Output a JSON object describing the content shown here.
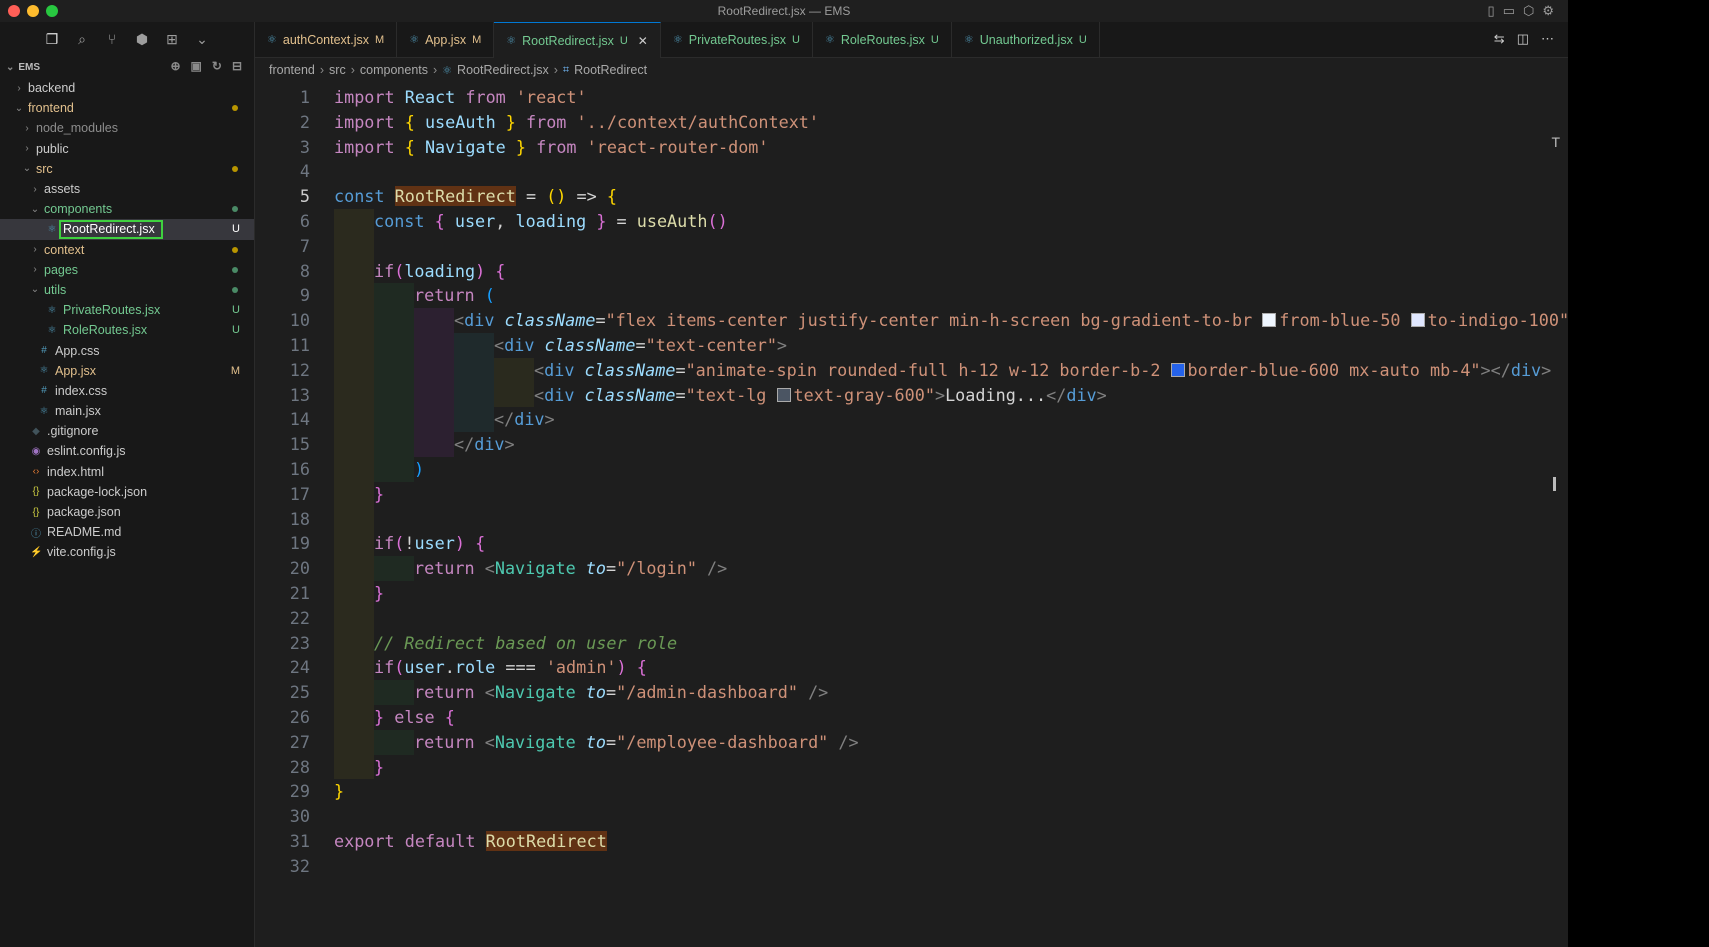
{
  "window": {
    "title": "RootRedirect.jsx — EMS"
  },
  "explorer": {
    "root": "EMS",
    "tree": [
      {
        "label": "backend",
        "kind": "folder",
        "depth": 0,
        "open": false,
        "color": "#cccccc"
      },
      {
        "label": "frontend",
        "kind": "folder",
        "depth": 0,
        "open": true,
        "color": "#e2c08d",
        "dot": "#b89500"
      },
      {
        "label": "node_modules",
        "kind": "folder",
        "depth": 1,
        "open": false,
        "color": "#8c8c8c"
      },
      {
        "label": "public",
        "kind": "folder",
        "depth": 1,
        "open": false,
        "color": "#cccccc"
      },
      {
        "label": "src",
        "kind": "folder",
        "depth": 1,
        "open": true,
        "color": "#e2c08d",
        "dot": "#b89500"
      },
      {
        "label": "assets",
        "kind": "folder",
        "depth": 2,
        "open": false,
        "color": "#cccccc"
      },
      {
        "label": "components",
        "kind": "folder",
        "depth": 2,
        "open": true,
        "color": "#73c991",
        "dot": "#4a8a66"
      },
      {
        "label": "RootRedirect.jsx",
        "kind": "file",
        "depth": 3,
        "icon": "react",
        "color": "#ffffff",
        "badge": "U",
        "selected": true
      },
      {
        "label": "context",
        "kind": "folder",
        "depth": 2,
        "open": false,
        "color": "#e2c08d",
        "dot": "#b89500"
      },
      {
        "label": "pages",
        "kind": "folder",
        "depth": 2,
        "open": false,
        "color": "#73c991",
        "dot": "#4a8a66"
      },
      {
        "label": "utils",
        "kind": "folder",
        "depth": 2,
        "open": true,
        "color": "#73c991",
        "dot": "#4a8a66"
      },
      {
        "label": "PrivateRoutes.jsx",
        "kind": "file",
        "depth": 3,
        "icon": "react",
        "color": "#73c991",
        "badge": "U"
      },
      {
        "label": "RoleRoutes.jsx",
        "kind": "file",
        "depth": 3,
        "icon": "react",
        "color": "#73c991",
        "badge": "U"
      },
      {
        "label": "App.css",
        "kind": "file",
        "depth": 2,
        "icon": "hash",
        "color": "#cccccc"
      },
      {
        "label": "App.jsx",
        "kind": "file",
        "depth": 2,
        "icon": "react",
        "color": "#e2c08d",
        "badge": "M"
      },
      {
        "label": "index.css",
        "kind": "file",
        "depth": 2,
        "icon": "hash",
        "color": "#cccccc"
      },
      {
        "label": "main.jsx",
        "kind": "file",
        "depth": 2,
        "icon": "react",
        "color": "#cccccc"
      },
      {
        "label": ".gitignore",
        "kind": "file",
        "depth": 1,
        "icon": "git",
        "color": "#cccccc"
      },
      {
        "label": "eslint.config.js",
        "kind": "file",
        "depth": 1,
        "icon": "eslint",
        "color": "#cccccc"
      },
      {
        "label": "index.html",
        "kind": "file",
        "depth": 1,
        "icon": "html",
        "color": "#cccccc"
      },
      {
        "label": "package-lock.json",
        "kind": "file",
        "depth": 1,
        "icon": "json",
        "color": "#cccccc"
      },
      {
        "label": "package.json",
        "kind": "file",
        "depth": 1,
        "icon": "json",
        "color": "#cccccc"
      },
      {
        "label": "README.md",
        "kind": "file",
        "depth": 1,
        "icon": "info",
        "color": "#cccccc"
      },
      {
        "label": "vite.config.js",
        "kind": "file",
        "depth": 1,
        "icon": "vite",
        "color": "#cccccc"
      }
    ]
  },
  "tabs": [
    {
      "label": "authContext.jsx",
      "status": "M",
      "color": "#e2c08d"
    },
    {
      "label": "App.jsx",
      "status": "M",
      "color": "#e2c08d"
    },
    {
      "label": "RootRedirect.jsx",
      "status": "U",
      "color": "#73c991",
      "active": true
    },
    {
      "label": "PrivateRoutes.jsx",
      "status": "U",
      "color": "#73c991"
    },
    {
      "label": "RoleRoutes.jsx",
      "status": "U",
      "color": "#73c991"
    },
    {
      "label": "Unauthorized.jsx",
      "status": "U",
      "color": "#73c991"
    }
  ],
  "breadcrumb": [
    "frontend",
    "src",
    "components",
    "RootRedirect.jsx",
    "RootRedirect"
  ],
  "editor": {
    "current_line": 5,
    "lines": [
      {
        "n": 1,
        "indent": 0,
        "tokens": [
          [
            "import ",
            "kw"
          ],
          [
            "React ",
            "var"
          ],
          [
            "from ",
            "kw"
          ],
          [
            "'react'",
            "str"
          ]
        ]
      },
      {
        "n": 2,
        "indent": 0,
        "tokens": [
          [
            "import ",
            "kw"
          ],
          [
            "{ ",
            "b1"
          ],
          [
            "useAuth ",
            "var"
          ],
          [
            "} ",
            "b1"
          ],
          [
            "from ",
            "kw"
          ],
          [
            "'../context/authContext'",
            "str"
          ]
        ]
      },
      {
        "n": 3,
        "indent": 0,
        "tokens": [
          [
            "import ",
            "kw"
          ],
          [
            "{ ",
            "b1"
          ],
          [
            "Navigate ",
            "var"
          ],
          [
            "} ",
            "b1"
          ],
          [
            "from ",
            "kw"
          ],
          [
            "'react-router-dom'",
            "str"
          ]
        ]
      },
      {
        "n": 4,
        "indent": 0,
        "tokens": []
      },
      {
        "n": 5,
        "indent": 0,
        "tokens": [
          [
            "const ",
            "kb"
          ],
          [
            "RootRedirect",
            "fn hlbox"
          ],
          [
            " = ",
            ""
          ],
          [
            "()",
            "b1"
          ],
          [
            " => ",
            ""
          ],
          [
            "{",
            "b1"
          ]
        ]
      },
      {
        "n": 6,
        "indent": 1,
        "tokens": [
          [
            "const ",
            "kb"
          ],
          [
            "{ ",
            "b2"
          ],
          [
            "user",
            "var"
          ],
          [
            ", ",
            ""
          ],
          [
            "loading ",
            "var"
          ],
          [
            "} ",
            "b2"
          ],
          [
            "= ",
            ""
          ],
          [
            "useAuth",
            "fn"
          ],
          [
            "()",
            "b2"
          ]
        ]
      },
      {
        "n": 7,
        "indent": 1,
        "tokens": []
      },
      {
        "n": 8,
        "indent": 1,
        "tokens": [
          [
            "if",
            "kw"
          ],
          [
            "(",
            "b2"
          ],
          [
            "loading",
            "var"
          ],
          [
            ") ",
            "b2"
          ],
          [
            "{",
            "b2"
          ]
        ]
      },
      {
        "n": 9,
        "indent": 2,
        "tokens": [
          [
            "return ",
            "kw"
          ],
          [
            "(",
            "b3"
          ]
        ]
      },
      {
        "n": 10,
        "indent": 3,
        "tokens": [
          [
            "<",
            "pn"
          ],
          [
            "div ",
            "tag"
          ],
          [
            "className",
            "attr"
          ],
          [
            "=",
            ""
          ],
          [
            "\"flex items-center justify-center min-h-screen bg-gradient-to-br ",
            "str"
          ],
          [
            "#eff6ff",
            "swatch"
          ],
          [
            "from-blue-50 ",
            "str"
          ],
          [
            "#e0e7ff",
            "swatch"
          ],
          [
            "to-indigo-100\"",
            "str"
          ],
          [
            ">",
            "pn"
          ]
        ]
      },
      {
        "n": 11,
        "indent": 4,
        "tokens": [
          [
            "<",
            "pn"
          ],
          [
            "div ",
            "tag"
          ],
          [
            "className",
            "attr"
          ],
          [
            "=",
            ""
          ],
          [
            "\"text-center\"",
            "str"
          ],
          [
            ">",
            "pn"
          ]
        ]
      },
      {
        "n": 12,
        "indent": 5,
        "tokens": [
          [
            "<",
            "pn"
          ],
          [
            "div ",
            "tag"
          ],
          [
            "className",
            "attr"
          ],
          [
            "=",
            ""
          ],
          [
            "\"animate-spin rounded-full h-12 w-12 border-b-2 ",
            "str"
          ],
          [
            "#2563eb",
            "swatch"
          ],
          [
            "border-blue-600 mx-auto mb-4\"",
            "str"
          ],
          [
            "></",
            "pn"
          ],
          [
            "div",
            "tag"
          ],
          [
            ">",
            "pn"
          ]
        ]
      },
      {
        "n": 13,
        "indent": 5,
        "tokens": [
          [
            "<",
            "pn"
          ],
          [
            "div ",
            "tag"
          ],
          [
            "className",
            "attr"
          ],
          [
            "=",
            ""
          ],
          [
            "\"text-lg ",
            "str"
          ],
          [
            "#4b5563",
            "swatch"
          ],
          [
            "text-gray-600\"",
            "str"
          ],
          [
            ">",
            "pn"
          ],
          [
            "Loading...",
            ""
          ],
          [
            "</",
            "pn"
          ],
          [
            "div",
            "tag"
          ],
          [
            ">",
            "pn"
          ]
        ]
      },
      {
        "n": 14,
        "indent": 4,
        "tokens": [
          [
            "</",
            "pn"
          ],
          [
            "div",
            "tag"
          ],
          [
            ">",
            "pn"
          ]
        ]
      },
      {
        "n": 15,
        "indent": 3,
        "tokens": [
          [
            "</",
            "pn"
          ],
          [
            "div",
            "tag"
          ],
          [
            ">",
            "pn"
          ]
        ]
      },
      {
        "n": 16,
        "indent": 2,
        "tokens": [
          [
            ")",
            "b3"
          ]
        ]
      },
      {
        "n": 17,
        "indent": 1,
        "tokens": [
          [
            "}",
            "b2"
          ]
        ]
      },
      {
        "n": 18,
        "indent": 1,
        "tokens": []
      },
      {
        "n": 19,
        "indent": 1,
        "tokens": [
          [
            "if",
            "kw"
          ],
          [
            "(",
            "b2"
          ],
          [
            "!",
            ""
          ],
          [
            "user",
            "var"
          ],
          [
            ") ",
            "b2"
          ],
          [
            "{",
            "b2"
          ]
        ]
      },
      {
        "n": 20,
        "indent": 2,
        "tokens": [
          [
            "return ",
            "kw"
          ],
          [
            "<",
            "pn"
          ],
          [
            "Navigate ",
            "comp"
          ],
          [
            "to",
            "attr"
          ],
          [
            "=",
            ""
          ],
          [
            "\"/login\" ",
            "str"
          ],
          [
            "/>",
            "pn"
          ]
        ]
      },
      {
        "n": 21,
        "indent": 1,
        "tokens": [
          [
            "}",
            "b2"
          ]
        ]
      },
      {
        "n": 22,
        "indent": 1,
        "tokens": []
      },
      {
        "n": 23,
        "indent": 1,
        "tokens": [
          [
            "// Redirect based on user role",
            "cm"
          ]
        ]
      },
      {
        "n": 24,
        "indent": 1,
        "tokens": [
          [
            "if",
            "kw"
          ],
          [
            "(",
            "b2"
          ],
          [
            "user",
            "var"
          ],
          [
            ".",
            ""
          ],
          [
            "role ",
            "var"
          ],
          [
            "=== ",
            ""
          ],
          [
            "'admin'",
            "str"
          ],
          [
            ") ",
            "b2"
          ],
          [
            "{",
            "b2"
          ]
        ]
      },
      {
        "n": 25,
        "indent": 2,
        "tokens": [
          [
            "return ",
            "kw"
          ],
          [
            "<",
            "pn"
          ],
          [
            "Navigate ",
            "comp"
          ],
          [
            "to",
            "attr"
          ],
          [
            "=",
            ""
          ],
          [
            "\"/admin-dashboard\" ",
            "str"
          ],
          [
            "/>",
            "pn"
          ]
        ]
      },
      {
        "n": 26,
        "indent": 1,
        "tokens": [
          [
            "} ",
            "b2"
          ],
          [
            "else ",
            "kw"
          ],
          [
            "{",
            "b2"
          ]
        ]
      },
      {
        "n": 27,
        "indent": 2,
        "tokens": [
          [
            "return ",
            "kw"
          ],
          [
            "<",
            "pn"
          ],
          [
            "Navigate ",
            "comp"
          ],
          [
            "to",
            "attr"
          ],
          [
            "=",
            ""
          ],
          [
            "\"/employee-dashboard\" ",
            "str"
          ],
          [
            "/>",
            "pn"
          ]
        ]
      },
      {
        "n": 28,
        "indent": 1,
        "tokens": [
          [
            "}",
            "b2"
          ]
        ]
      },
      {
        "n": 29,
        "indent": 0,
        "tokens": [
          [
            "}",
            "b1"
          ]
        ]
      },
      {
        "n": 30,
        "indent": 0,
        "tokens": []
      },
      {
        "n": 31,
        "indent": 0,
        "tokens": [
          [
            "export ",
            "kw"
          ],
          [
            "default ",
            "kw"
          ],
          [
            "RootRedirect",
            "fn hlbox"
          ]
        ]
      },
      {
        "n": 32,
        "indent": 0,
        "tokens": []
      }
    ]
  }
}
